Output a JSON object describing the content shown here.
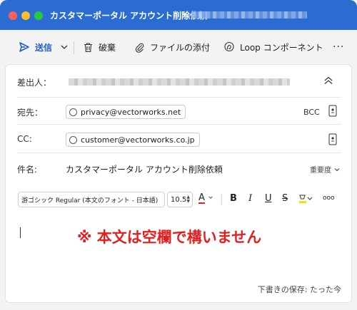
{
  "window": {
    "title": "カスタマーポータル アカウント削除依頼",
    "title_separator": "•"
  },
  "toolbar": {
    "send_label": "送信",
    "discard_label": "破棄",
    "attach_label": "ファイルの添付",
    "loop_label": "Loop コンポーネント",
    "more_label": "···"
  },
  "compose": {
    "from_label": "差出人：",
    "to_label": "宛先：",
    "to_recipient": "privacy@vectorworks.net",
    "bcc_label": "BCC",
    "cc_label": "CC:",
    "cc_recipient": "customer@vectorworks.co.jp",
    "subject_label": "件名:",
    "subject_value": "カスタマーポータル アカウント削除依頼",
    "importance_label": "重要度"
  },
  "format": {
    "font": "游ゴシック Regular (本文のフォント - 日本語)",
    "size": "10.5",
    "color_glyph": "A",
    "bold": "B",
    "italic": "I",
    "underline": "U",
    "strike": "S",
    "more": "ooo",
    "accent_color": "#e02020",
    "highlight_color": "#f2e000"
  },
  "body": {
    "note": "※ 本文は空欄で構いません",
    "draft_status": "下書きの保存: たった今"
  },
  "colors": {
    "titlebar": "#2b6cd1",
    "send": "#1f5fc6",
    "note": "#e02020"
  }
}
